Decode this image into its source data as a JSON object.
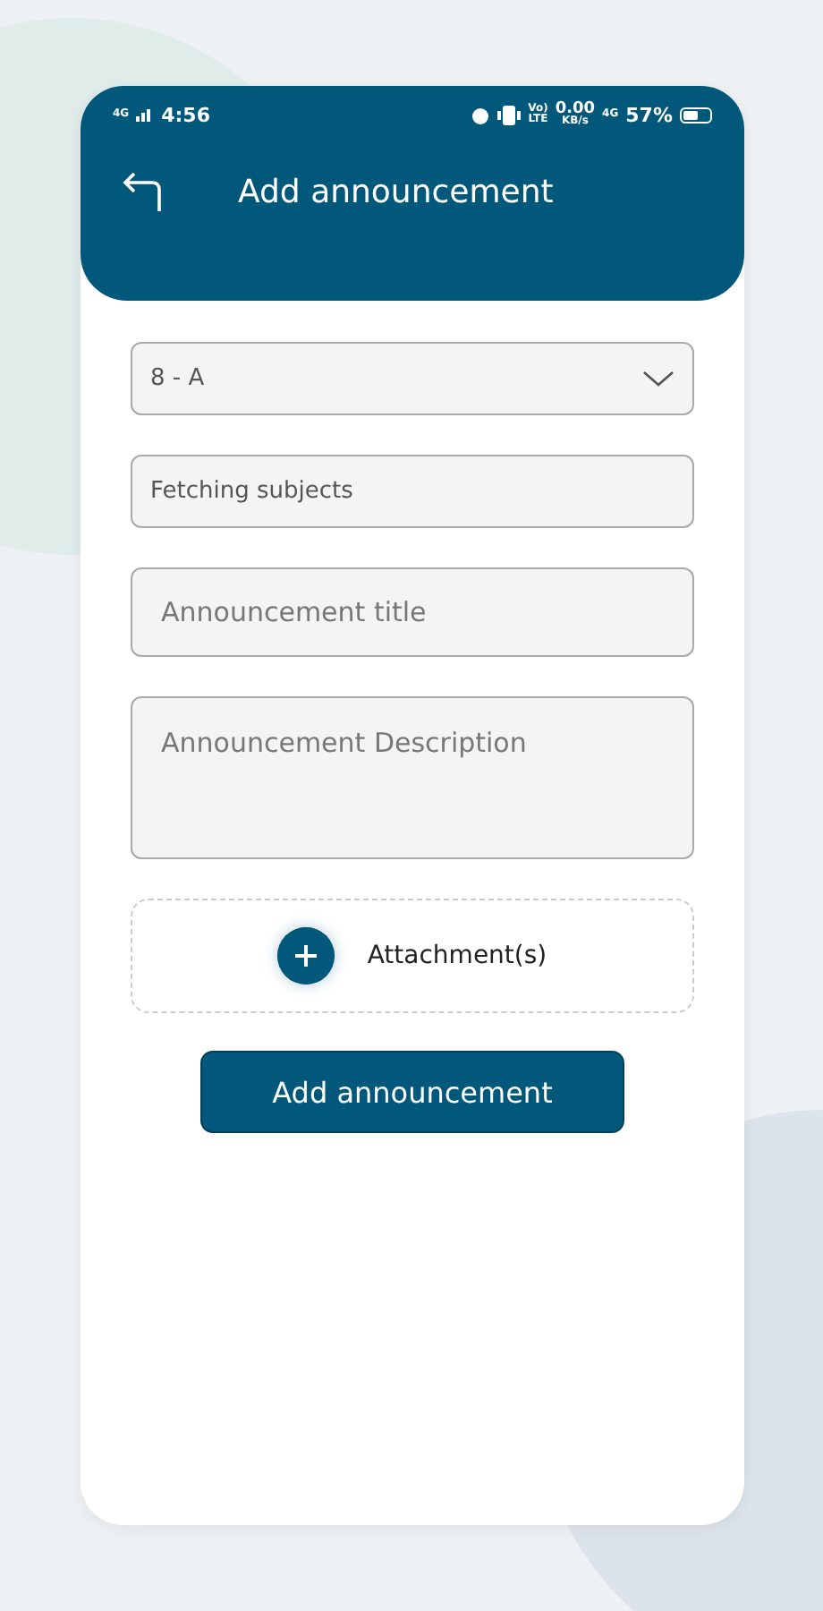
{
  "status_bar": {
    "network": "4G",
    "time": "4:56",
    "volte_top": "Vo)",
    "volte_bottom": "LTE",
    "speed": "0.00",
    "speed_unit": "KB/s",
    "network_right": "4G",
    "battery": "57%"
  },
  "header": {
    "title": "Add announcement"
  },
  "fields": [
    {
      "kind": "dropdown",
      "value": "8 - A"
    },
    {
      "kind": "text",
      "value": "Fetching subjects"
    },
    {
      "kind": "input",
      "placeholder": "Announcement title"
    },
    {
      "kind": "textarea",
      "placeholder": "Announcement Description"
    }
  ],
  "attachment": {
    "label": "Attachment(s)"
  },
  "submit_button": {
    "label": "Add announcement"
  }
}
